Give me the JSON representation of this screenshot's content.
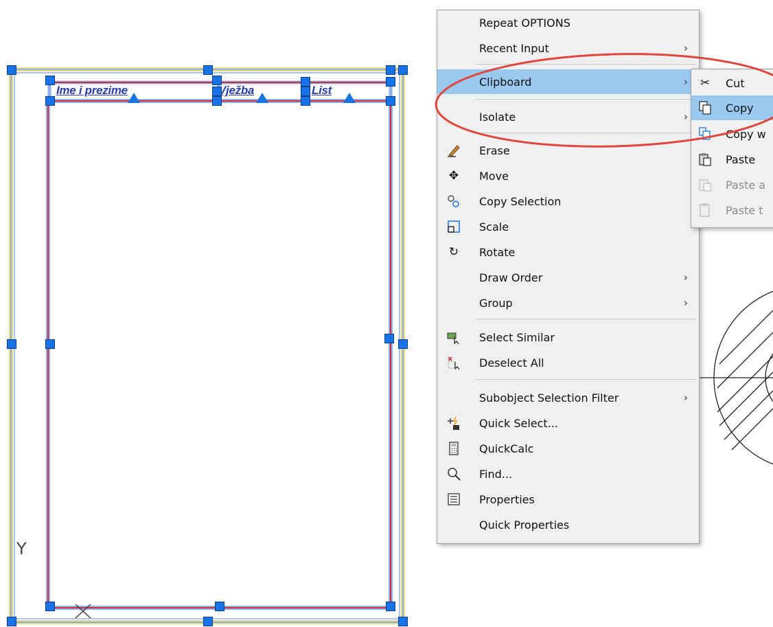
{
  "drawing": {
    "title_fields": [
      "Ime i prezime",
      "Vježba",
      "List"
    ],
    "ucs_y_label": "Y"
  },
  "context_menu": {
    "items": [
      {
        "label": "Repeat OPTIONS",
        "icon": "",
        "submenu": false
      },
      {
        "label": "Recent Input",
        "icon": "",
        "submenu": true
      },
      {
        "label": "Clipboard",
        "icon": "",
        "submenu": true,
        "highlighted": true
      },
      {
        "label": "Isolate",
        "icon": "",
        "submenu": true
      },
      {
        "label": "Erase",
        "icon": "eraser-icon",
        "submenu": false
      },
      {
        "label": "Move",
        "icon": "move-icon",
        "submenu": false
      },
      {
        "label": "Copy Selection",
        "icon": "copy-selection-icon",
        "submenu": false
      },
      {
        "label": "Scale",
        "icon": "scale-icon",
        "submenu": false
      },
      {
        "label": "Rotate",
        "icon": "rotate-icon",
        "submenu": false
      },
      {
        "label": "Draw Order",
        "icon": "",
        "submenu": true
      },
      {
        "label": "Group",
        "icon": "",
        "submenu": true
      },
      {
        "label": "Select Similar",
        "icon": "select-similar-icon",
        "submenu": false
      },
      {
        "label": "Deselect All",
        "icon": "deselect-all-icon",
        "submenu": false
      },
      {
        "label": "Subobject Selection Filter",
        "icon": "",
        "submenu": true
      },
      {
        "label": "Quick Select...",
        "icon": "quick-select-icon",
        "submenu": false
      },
      {
        "label": "QuickCalc",
        "icon": "calculator-icon",
        "submenu": false
      },
      {
        "label": "Find...",
        "icon": "find-icon",
        "submenu": false
      },
      {
        "label": "Properties",
        "icon": "properties-icon",
        "submenu": false
      },
      {
        "label": "Quick Properties",
        "icon": "",
        "submenu": false
      }
    ]
  },
  "clipboard_submenu": {
    "items": [
      {
        "label": "Cut",
        "icon": "scissors-icon",
        "enabled": true
      },
      {
        "label": "Copy",
        "icon": "copy-icon",
        "enabled": true,
        "highlighted": true
      },
      {
        "label": "Copy w",
        "icon": "copy-with-base-point-icon",
        "enabled": true
      },
      {
        "label": "Paste",
        "icon": "paste-icon",
        "enabled": true
      },
      {
        "label": "Paste a",
        "icon": "paste-as-block-icon",
        "enabled": false
      },
      {
        "label": "Paste t",
        "icon": "paste-to-original-coordinates-icon",
        "enabled": false
      }
    ]
  },
  "colors": {
    "grip": "#1874e6",
    "highlight": "#99c9f1",
    "annotation_ellipse": "#e0463c",
    "frame_red": "#d0303c",
    "frame_yellow": "#e8d97a",
    "frame_blue": "#8fb0ea"
  }
}
